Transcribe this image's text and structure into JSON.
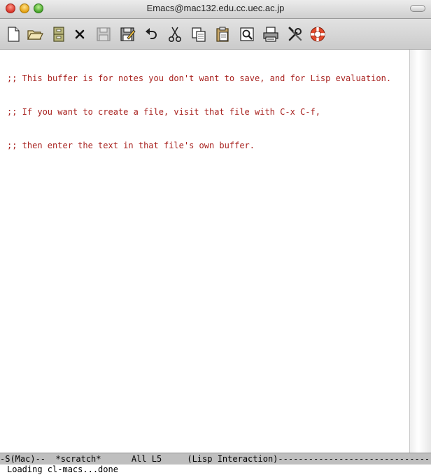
{
  "window": {
    "title": "Emacs@mac132.edu.cc.uec.ac.jp"
  },
  "toolbar": {
    "items": [
      {
        "name": "new-file",
        "icon": "new-file-icon"
      },
      {
        "name": "open-folder",
        "icon": "open-folder-icon"
      },
      {
        "name": "dired",
        "icon": "file-cabinet-icon"
      },
      {
        "name": "kill-buffer",
        "icon": "close-x-icon"
      },
      {
        "name": "save",
        "icon": "floppy-disk-icon"
      },
      {
        "name": "save-as",
        "icon": "floppy-pencil-icon"
      },
      {
        "name": "undo",
        "icon": "undo-arrow-icon"
      },
      {
        "name": "cut",
        "icon": "scissors-icon"
      },
      {
        "name": "copy",
        "icon": "copy-icon"
      },
      {
        "name": "paste",
        "icon": "clipboard-icon"
      },
      {
        "name": "search",
        "icon": "magnifier-icon"
      },
      {
        "name": "print",
        "icon": "printer-icon"
      },
      {
        "name": "customize",
        "icon": "tools-icon"
      },
      {
        "name": "help",
        "icon": "lifebuoy-icon"
      }
    ]
  },
  "buffer": {
    "lines": [
      ";; This buffer is for notes you don't want to save, and for Lisp evaluation.",
      ";; If you want to create a file, visit that file with C-x C-f,",
      ";; then enter the text in that file's own buffer."
    ],
    "text_color": "#a8221f"
  },
  "modeline": {
    "coding": "-S(Mac)--",
    "buffer_name": "*scratch*",
    "position": "All L5",
    "mode": "(Lisp Interaction)",
    "fill": "------------------------------------"
  },
  "echo": {
    "message": "Loading cl-macs...done"
  }
}
